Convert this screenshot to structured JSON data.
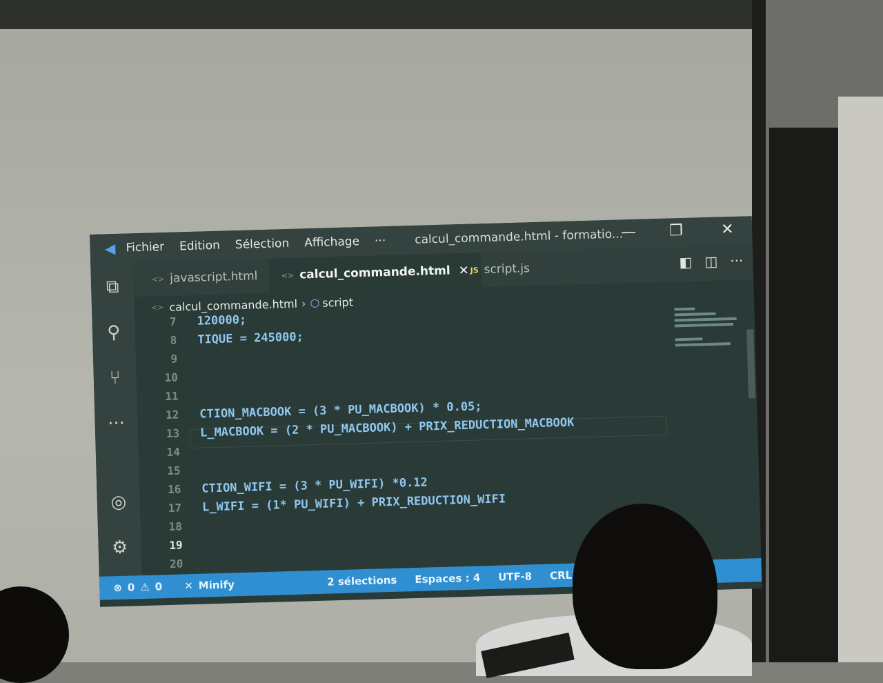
{
  "titlebar": {
    "menu": [
      "Fichier",
      "Edition",
      "Sélection",
      "Affichage",
      "···"
    ],
    "window_title": "calcul_commande.html - formatio..."
  },
  "tabs": [
    {
      "label": "javascript.html",
      "active": false,
      "icon": "html-file-icon"
    },
    {
      "label": "calcul_commande.html",
      "active": true,
      "icon": "html-file-icon"
    },
    {
      "label": "script.js",
      "active": false,
      "icon": "js-file-icon",
      "badge": "JS"
    }
  ],
  "breadcrumb": {
    "file": "calcul_commande.html",
    "symbol": "script"
  },
  "editor": {
    "lines": [
      {
        "n": "7",
        "code": "120000;"
      },
      {
        "n": "8",
        "code": "TIQUE = 245000;"
      },
      {
        "n": "9",
        "code": ""
      },
      {
        "n": "10",
        "code": ""
      },
      {
        "n": "11",
        "code": ""
      },
      {
        "n": "12",
        "code": "CTION_MACBOOK = (3 * PU_MACBOOK) * 0.05;"
      },
      {
        "n": "13",
        "code": "L_MACBOOK = (2 * PU_MACBOOK) + PRIX_REDUCTION_MACBOOK"
      },
      {
        "n": "14",
        "code": ""
      },
      {
        "n": "15",
        "code": ""
      },
      {
        "n": "16",
        "code": "CTION_WIFI = (3 * PU_WIFI) *0.12"
      },
      {
        "n": "17",
        "code": "L_WIFI = (1* PU_WIFI) + PRIX_REDUCTION_WIFI"
      },
      {
        "n": "18",
        "code": ""
      },
      {
        "n": "19",
        "code": ""
      },
      {
        "n": "20",
        "code": ""
      }
    ]
  },
  "statusbar": {
    "errors": "0",
    "warnings": "0",
    "minify": "Minify",
    "selections": "2 sélections",
    "spaces": "Espaces : 4",
    "encoding": "UTF-8",
    "eol": "CRLF"
  },
  "colors": {
    "statusbar": "#2f8fd0",
    "editor_bg": "#2a3a37",
    "code": "#8fc7ef"
  }
}
